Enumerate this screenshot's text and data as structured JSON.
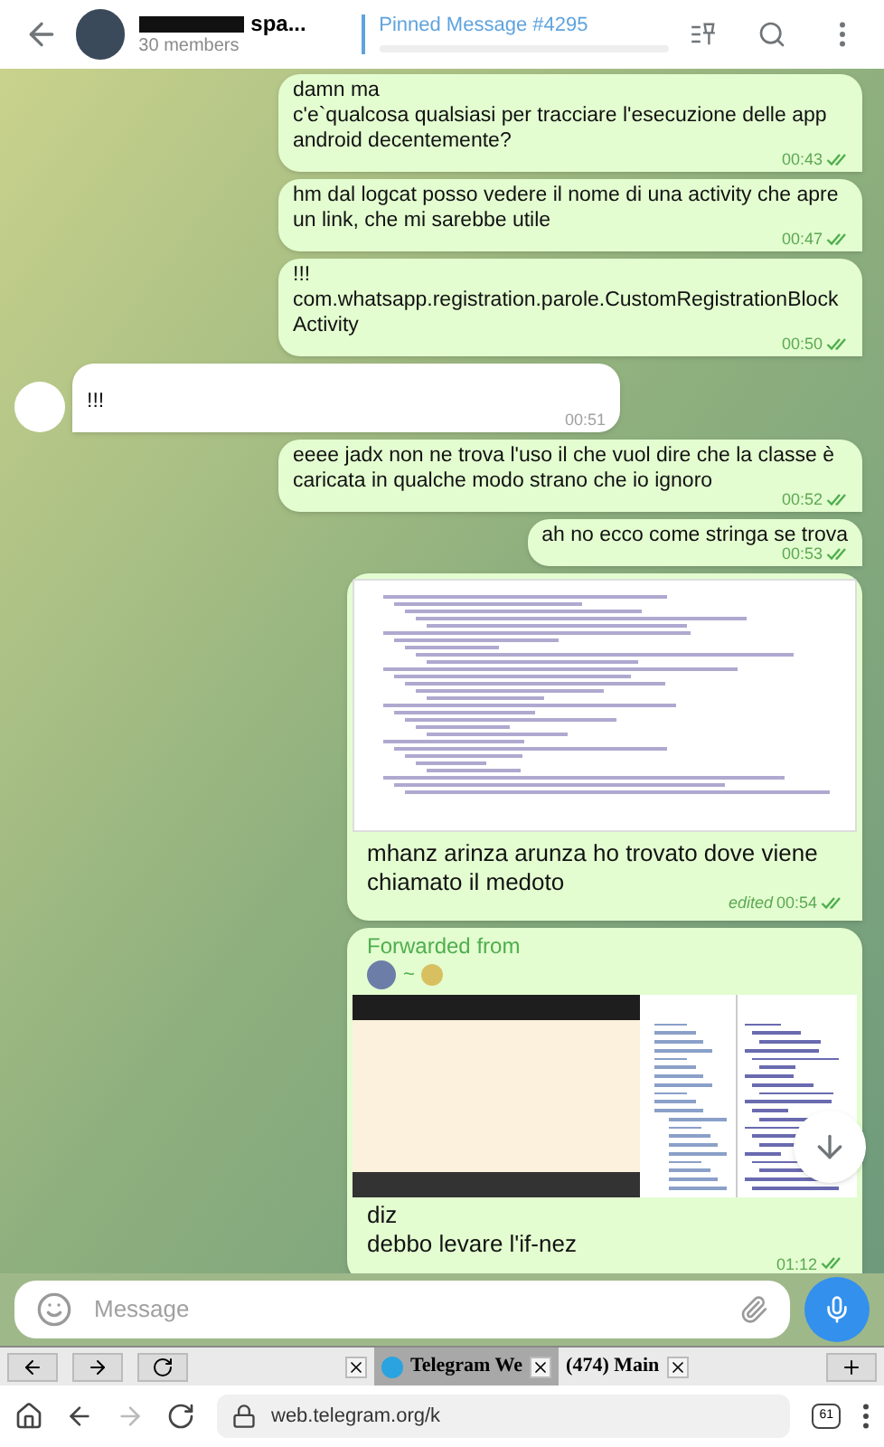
{
  "header": {
    "title": "spa...",
    "subtitle": "30 members",
    "pinned": "Pinned Message #4295"
  },
  "messages": [
    {
      "kind": "text",
      "outgoing": true,
      "text": "damn ma\nc'e`qualcosa qualsiasi per tracciare l'esecuzione delle app android decentemente?",
      "time": "00:43",
      "read": true
    },
    {
      "kind": "text",
      "outgoing": true,
      "text": "hm dal logcat posso vedere il nome di una activity che apre un link, che mi sarebbe utile",
      "time": "00:47",
      "read": true
    },
    {
      "kind": "text",
      "outgoing": true,
      "text": "!!!\ncom.whatsapp.registration.parole.CustomRegistrationBlockActivity",
      "time": "00:50",
      "read": true
    },
    {
      "kind": "text",
      "outgoing": false,
      "text": "!!!",
      "time": "00:51"
    },
    {
      "kind": "text",
      "outgoing": true,
      "text": "eeee jadx non ne trova l'uso il che vuol dire che la classe è caricata in qualche modo strano che io ignoro",
      "time": "00:52",
      "read": true
    },
    {
      "kind": "text",
      "outgoing": true,
      "text": "ah no ecco come stringa se trova",
      "time": "00:53",
      "read": true
    },
    {
      "kind": "image",
      "outgoing": true,
      "text": "mhanz arinza arunza ho trovato dove viene chiamato il medoto",
      "time": "00:54",
      "read": true,
      "edited_label": "edited"
    },
    {
      "kind": "forwarded",
      "outgoing": true,
      "forwarded_label": "Forwarded from",
      "forwarded_name": "~",
      "text": "diz\ndebbo levare l'if-nez",
      "time": "01:12",
      "read": true
    }
  ],
  "composer": {
    "placeholder": "Message"
  },
  "browser": {
    "tabs": [
      {
        "selected": false
      },
      {
        "title": "Telegram We",
        "selected": true
      },
      {
        "title": "(474) Main",
        "selected": false
      }
    ],
    "address": "web.telegram.org/k",
    "tab_count": "61"
  }
}
